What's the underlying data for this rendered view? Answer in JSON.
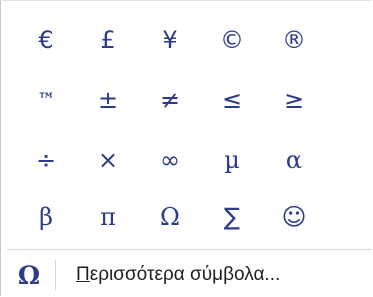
{
  "symbols_panel": {
    "rows": [
      [
        "€",
        "£",
        "¥",
        "©",
        "®"
      ],
      [
        "™",
        "±",
        "≠",
        "≤",
        "≥"
      ],
      [
        "÷",
        "×",
        "∞",
        "µ",
        "α"
      ],
      [
        "β",
        "π",
        "Ω",
        "∑",
        "☺"
      ]
    ]
  },
  "more_symbols": {
    "icon": "Ω",
    "accelerator": "Π",
    "label_rest": "ερισσότερα σύμβολα..."
  }
}
